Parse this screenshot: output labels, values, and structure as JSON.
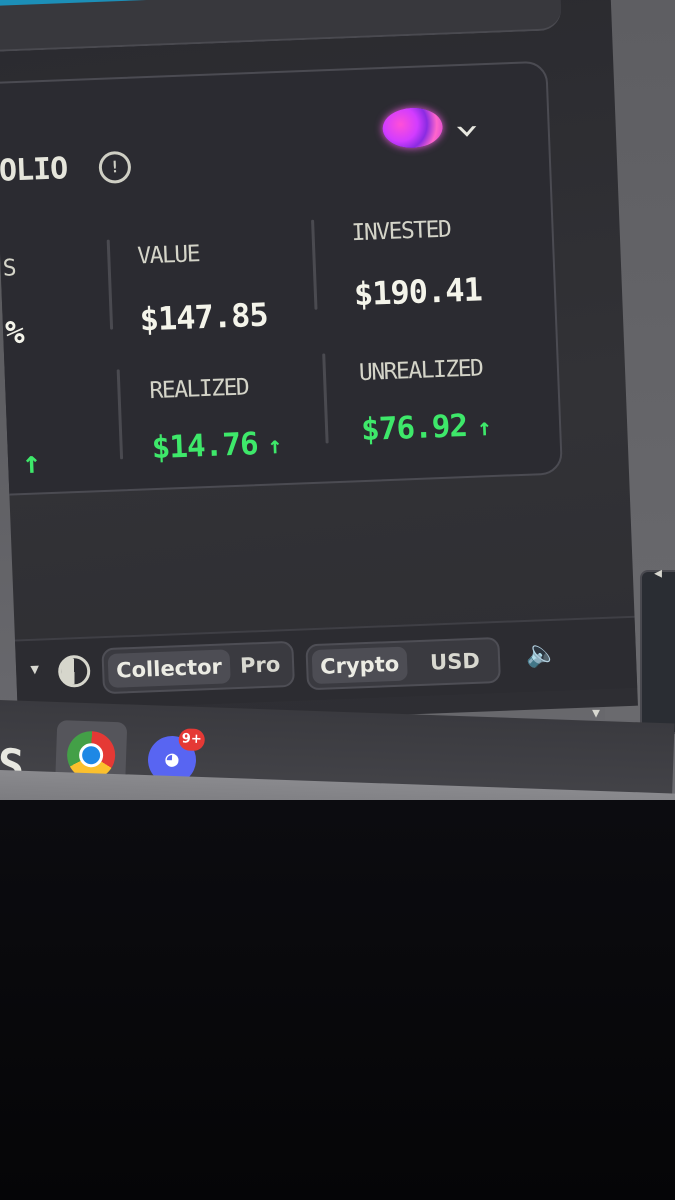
{
  "portfolio": {
    "title": "OLIO",
    "info_icon": "info-icon",
    "avatar_icon": "avatar",
    "dropdown_icon": "chevron-down-icon",
    "left_partial": {
      "top_label": "S",
      "top_value": "%",
      "bottom_value_arrow": "↑"
    },
    "value": {
      "label": "VALUE",
      "amount": "$147.85"
    },
    "invested": {
      "label": "INVESTED",
      "amount": "$190.41"
    },
    "realized": {
      "label": "REALIZED",
      "amount": "$14.76"
    },
    "unrealized": {
      "label": "UNREALIZED",
      "amount": "$76.92"
    },
    "up_arrow": "↑",
    "positive_color": "#3ee86a"
  },
  "toolbar": {
    "partial_left": "▾",
    "contrast_icon": "contrast-icon",
    "mode": {
      "options": [
        "Collector",
        "Pro"
      ],
      "selected": "Collector"
    },
    "currency": {
      "options": [
        "Crypto",
        "USD"
      ],
      "selected": "Crypto"
    },
    "volume_icon": "volume-icon"
  },
  "taskbar": {
    "apps": [
      {
        "name": "S-app",
        "label": "S"
      },
      {
        "name": "chrome",
        "active": true
      },
      {
        "name": "discord",
        "badge": "9+"
      }
    ]
  },
  "side": {
    "left_arrow": "◂",
    "down_arrow": "▾"
  }
}
